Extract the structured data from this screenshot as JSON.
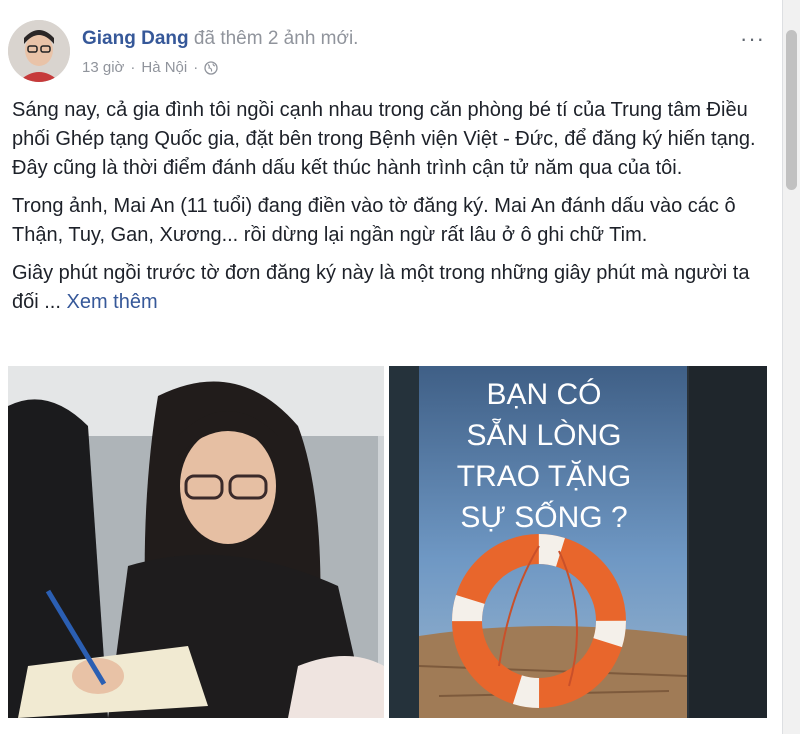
{
  "post": {
    "author": "Giang Dang",
    "action": " đã thêm 2 ảnh mới.",
    "time": "13 giờ",
    "separator": "·",
    "location": "Hà Nội",
    "privacy_icon": "globe-icon",
    "more_label": "···",
    "paragraphs": [
      "Sáng nay, cả gia đình tôi ngồi cạnh nhau trong căn phòng bé tí của Trung tâm Điều phối Ghép tạng Quốc gia, đặt bên trong Bệnh viện Việt - Đức, để đăng ký hiến tạng. Đây cũng là thời điểm đánh dấu kết thúc hành trình cận tử năm qua của tôi.",
      "Trong ảnh, Mai An (11 tuổi) đang điền vào tờ đăng ký. Mai An đánh dấu vào các ô Thận, Tuy, Gan, Xương... rồi dừng lại ngần ngừ rất lâu ở ô ghi chữ Tim.",
      "Giây phút ngồi trước tờ đơn đăng ký này là một trong những giây phút mà người ta đối ..."
    ],
    "see_more": " Xem thêm"
  },
  "photos": {
    "banner_lines": [
      "BẠN CÓ",
      "SẴN LÒNG",
      "TRAO TẶNG",
      "SỰ SỐNG ?"
    ]
  },
  "colors": {
    "author": "#365899",
    "meta": "#90949c",
    "text": "#1d2129",
    "lifebuoy": "#e8662c"
  }
}
